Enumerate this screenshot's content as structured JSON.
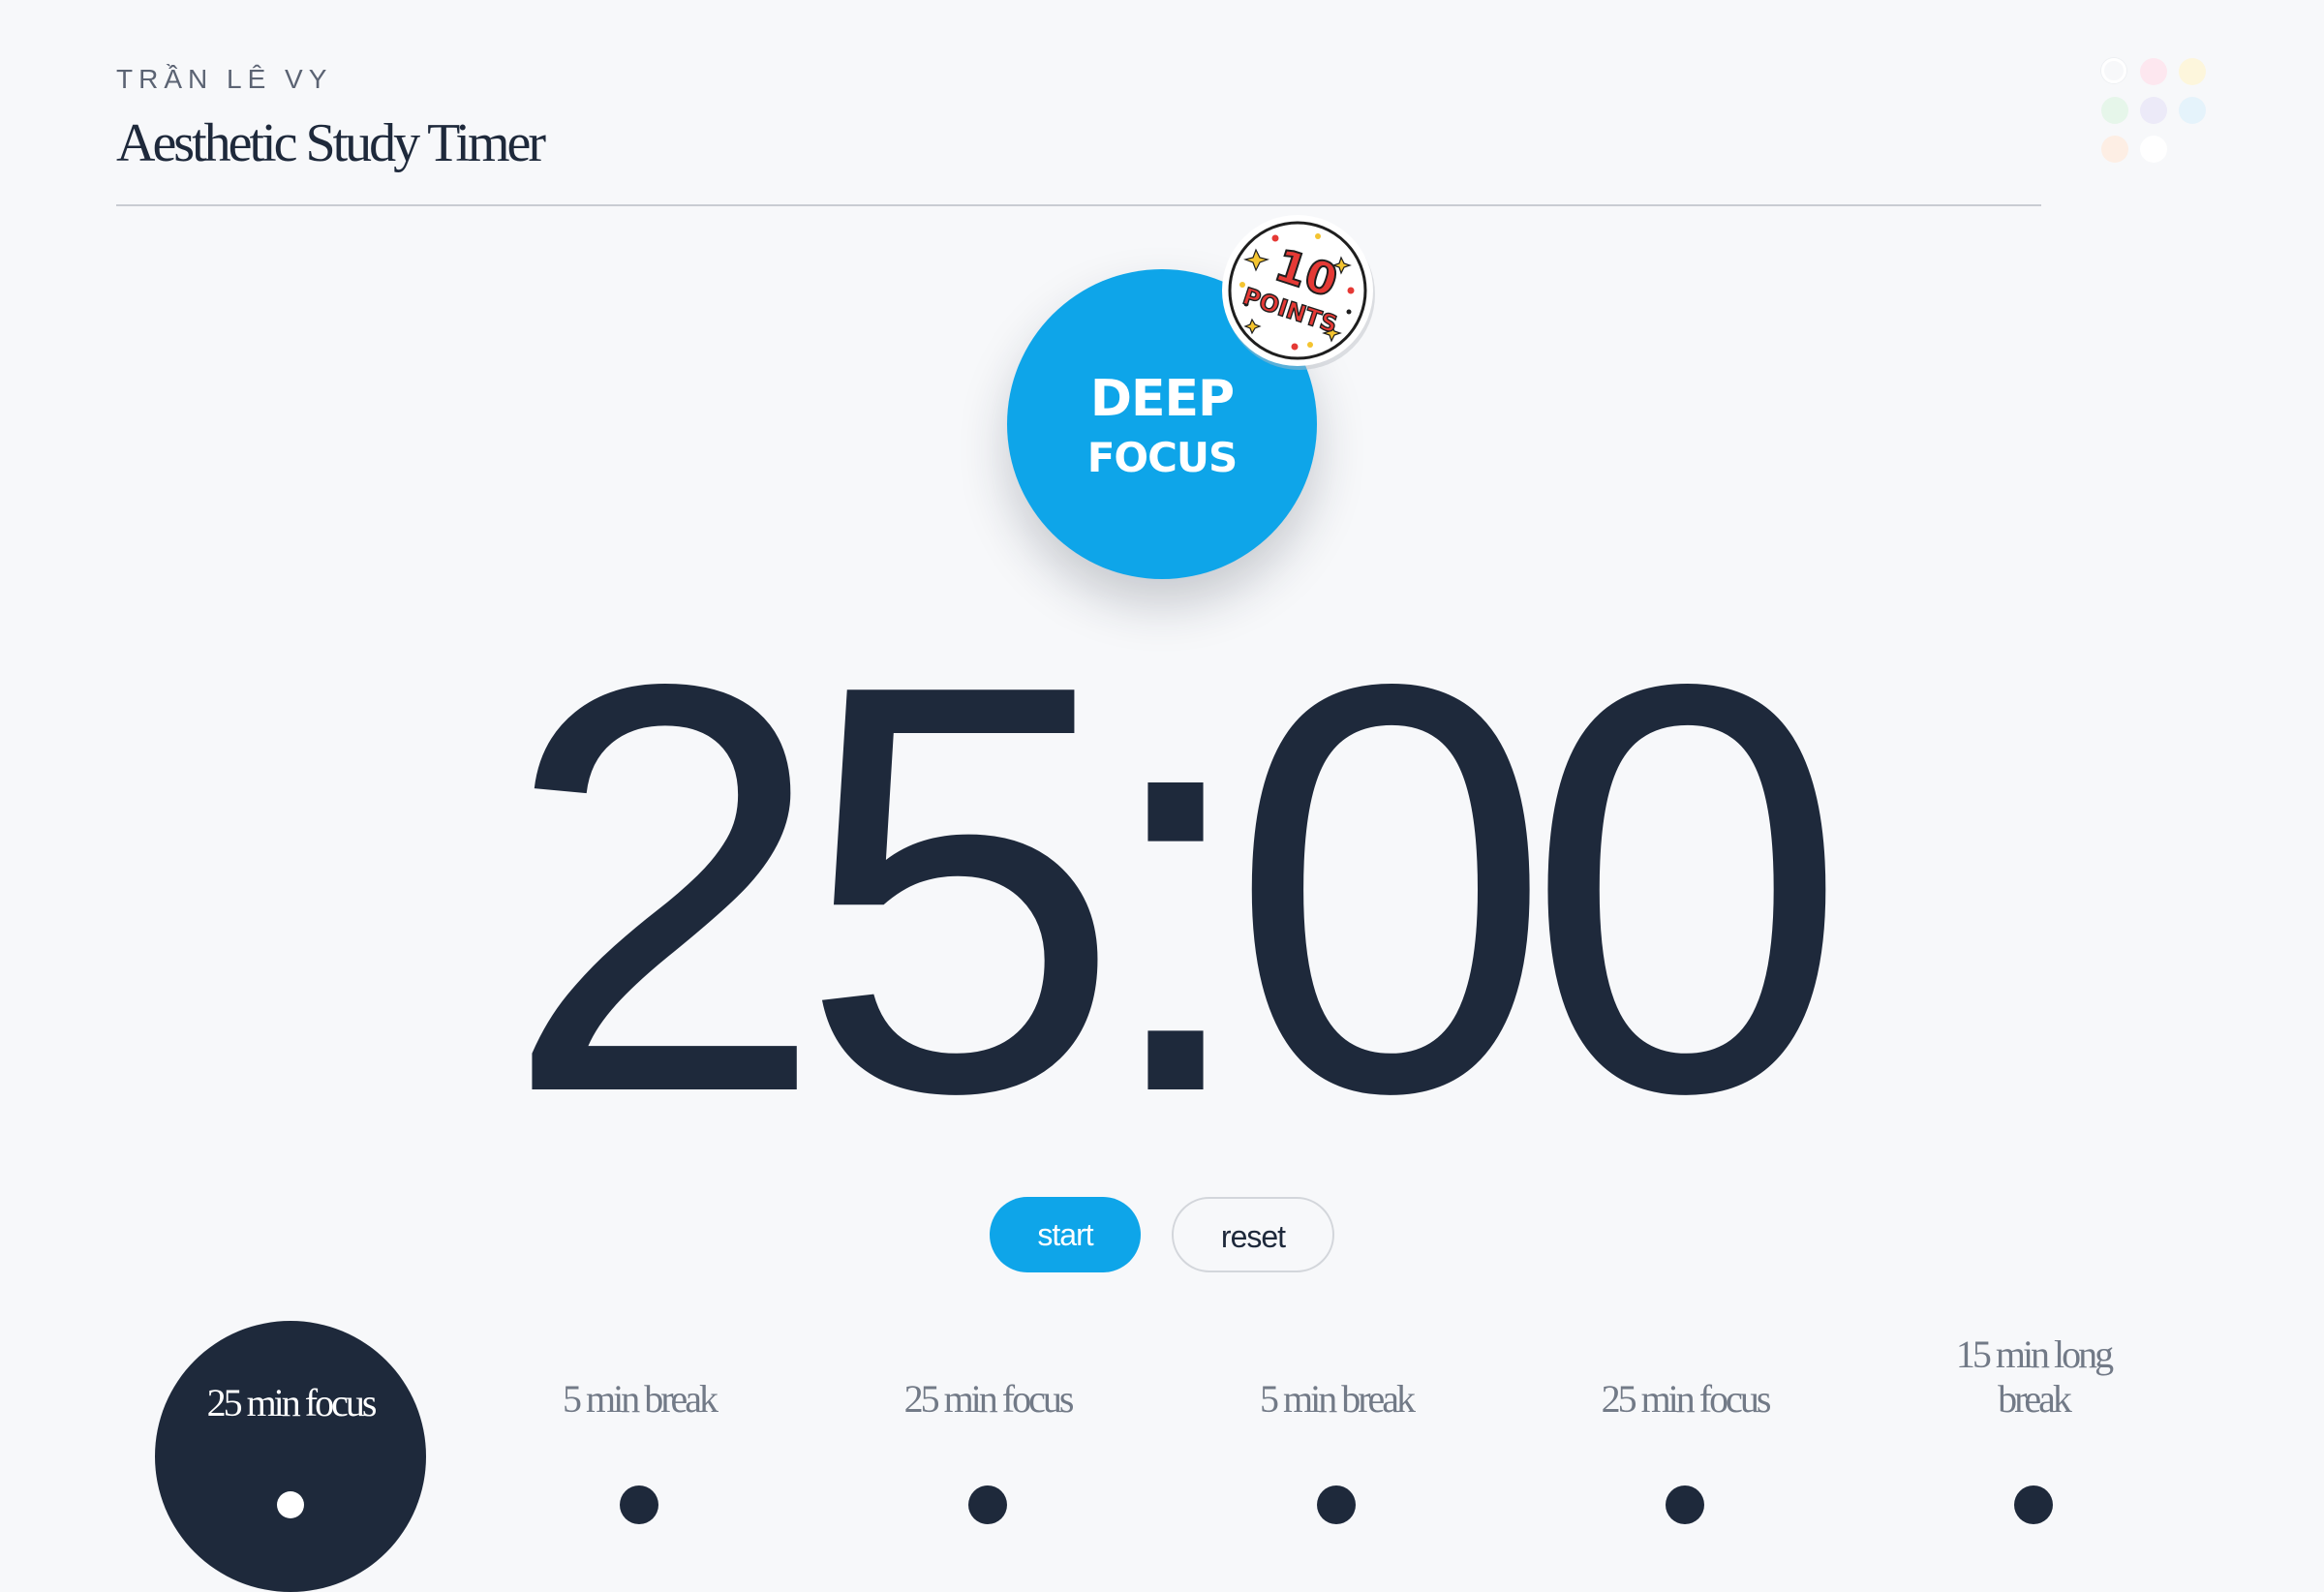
{
  "header": {
    "author": "TRẦN LÊ VY",
    "title": "Aesthetic Study Timer"
  },
  "palette": {
    "swatches": [
      {
        "icon": "palette-swatch-white-ring",
        "color": "#ffffff"
      },
      {
        "icon": "palette-swatch-pink",
        "color": "#fde7ef"
      },
      {
        "icon": "palette-swatch-yellow",
        "color": "#fdf6dc"
      },
      {
        "icon": "palette-swatch-green",
        "color": "#e6f6ea"
      },
      {
        "icon": "palette-swatch-lavender",
        "color": "#eceaf8"
      },
      {
        "icon": "palette-swatch-sky",
        "color": "#e5f3fb"
      },
      {
        "icon": "palette-swatch-peach",
        "color": "#fdeee4"
      },
      {
        "icon": "palette-swatch-white",
        "color": "#ffffff"
      }
    ]
  },
  "mode_badge": {
    "line1": "DEEP",
    "line2": "FOCUS",
    "color": "#0ea5e9"
  },
  "sticker": {
    "icon": "ten-points-sticker-icon",
    "text_top": "10",
    "text_bottom": "POINTS"
  },
  "timer": {
    "display": "25:00"
  },
  "controls": {
    "start_label": "start",
    "reset_label": "reset",
    "accent": "#0ea5e9"
  },
  "sessions": [
    {
      "label": "25 min focus",
      "active": true
    },
    {
      "label": "5 min break",
      "active": false
    },
    {
      "label": "25 min focus",
      "active": false
    },
    {
      "label": "5 min break",
      "active": false
    },
    {
      "label": "25 min focus",
      "active": false
    },
    {
      "label": "15 min long break",
      "active": false
    }
  ],
  "colors": {
    "ink": "#1e293b",
    "muted": "#727a87",
    "background": "#f7f8fa"
  }
}
